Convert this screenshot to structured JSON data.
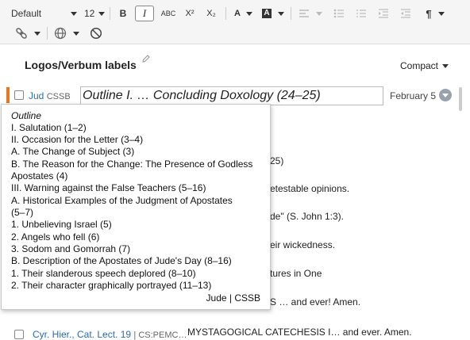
{
  "toolbar": {
    "font": "Default",
    "size": "12",
    "bold": "B",
    "italic": "I",
    "smallcaps": "ABC",
    "superscript": "X²",
    "subscript": "X₂",
    "font_color": "A",
    "highlight": "A",
    "paragraph": "¶"
  },
  "panel": {
    "title": "Logos/Verbum labels",
    "view": "Compact"
  },
  "row1": {
    "ref": "Jud",
    "resource": "CSSB",
    "label": "Outline I.  … Concluding Doxology (24–25)",
    "date": "February 5"
  },
  "background_snippets": {
    "s1": "25)",
    "s2": "etestable opinions.",
    "s3": "de\" (S. John 1:3).",
    "s4": "eir wickedness.",
    "s5": "tures in One",
    "s6": "S … and ever! Amen.",
    "s7": "MYSTAGOGICAL CATECHESIS I… and ever. Amen."
  },
  "tooltip": {
    "heading": "Outline",
    "lines": [
      "I.      Salutation (1–2)",
      "II.      Occasion for the Letter (3–4)",
      "A.      The Change of Subject (3)",
      "B.      The Reason for the Change: The Presence of Godless",
      "Apostates (4)",
      "III.      Warning against the False Teachers (5–16)",
      "A.      Historical Examples of the Judgment of Apostates",
      "(5–7)",
      "1.      Unbelieving Israel (5)",
      "2.      Angels who fell (6)",
      "3.      Sodom and Gomorrah (7)",
      "B.      Description of the Apostates of Jude's Day (8–16)",
      "1.      Their slanderous speech deplored (8–10)",
      "2.      Their character graphically portrayed (11–13)"
    ],
    "footer": "Jude | CSSB"
  },
  "bottom_row": {
    "ref": "Cyr. Hier., Cat. Lect. 19",
    "resource": "| CS:PEMC…"
  }
}
